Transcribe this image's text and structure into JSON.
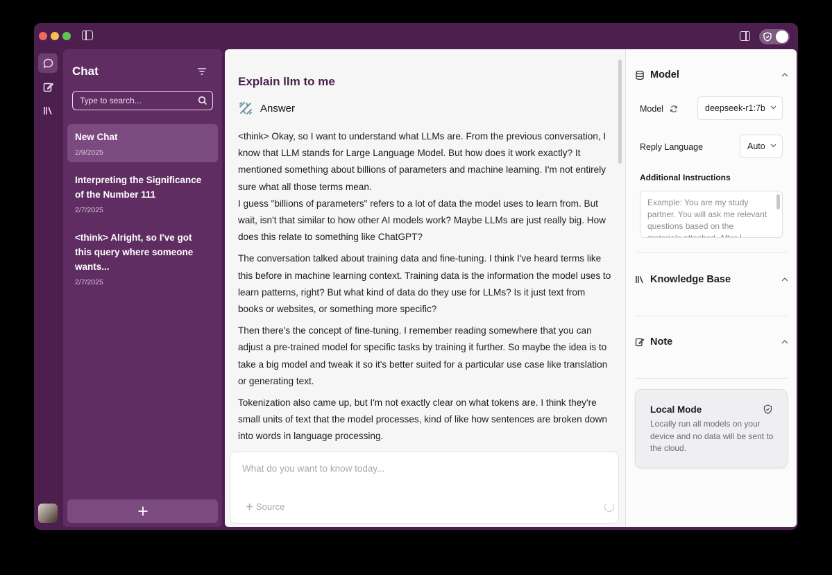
{
  "sidebar": {
    "title": "Chat",
    "search_placeholder": "Type to search...",
    "chats": [
      {
        "title": "New Chat",
        "date": "2/9/2025"
      },
      {
        "title": "Interpreting the Significance of the Number 111",
        "date": "2/7/2025"
      },
      {
        "title": "<think> Alright, so I've got this query where someone wants...",
        "date": "2/7/2025"
      }
    ],
    "new_chat_symbol": "+"
  },
  "main": {
    "question": "Explain llm to me",
    "answer_label": "Answer",
    "paragraphs": [
      "<think> Okay, so I want to understand what LLMs are. From the previous conversation, I know that LLM stands for Large Language Model. But how does it work exactly? It mentioned something about billions of parameters and machine learning. I'm not entirely sure what all those terms mean.",
      "I guess \"billions of parameters\" refers to a lot of data the model uses to learn from. But wait, isn't that similar to how other AI models work? Maybe LLMs are just really big. How does this relate to something like ChatGPT?",
      "The conversation talked about training data and fine-tuning. I think I've heard terms like this before in machine learning context. Training data is the information the model uses to learn patterns, right? But what kind of data do they use for LLMs? Is it just text from books or websites, or something more specific?",
      "Then there's the concept of fine-tuning. I remember reading somewhere that you can adjust a pre-trained model for specific tasks by training it further. So maybe the idea is to take a big model and tweak it so it's better suited for a particular use case like translation or generating text.",
      "Tokenization also came up, but I'm not exactly clear on what tokens are. I think they're small units of text that the model processes, kind of like how sentences are broken down into words in language processing."
    ],
    "composer_placeholder": "What do you want to know today...",
    "source_label": "Source"
  },
  "right": {
    "model_section": "Model",
    "model_label": "Model",
    "model_value": "deepseek-r1:7b",
    "reply_language_label": "Reply Language",
    "reply_language_value": "Auto",
    "instructions_label": "Additional Instructions",
    "instructions_placeholder": "Example: You are my study partner. You will ask me relevant questions based on the materials attached. After I answer, you will give feedback.",
    "knowledge_section": "Knowledge Base",
    "note_section": "Note",
    "local_mode_title": "Local Mode",
    "local_mode_desc": "Locally run all models on your device and no data will be sent to the cloud."
  },
  "colors": {
    "frame": "#4d1f4f",
    "sidebar": "#5f2d62",
    "active_item": "#7b4a7e",
    "title_accent": "#4a1f4c"
  }
}
